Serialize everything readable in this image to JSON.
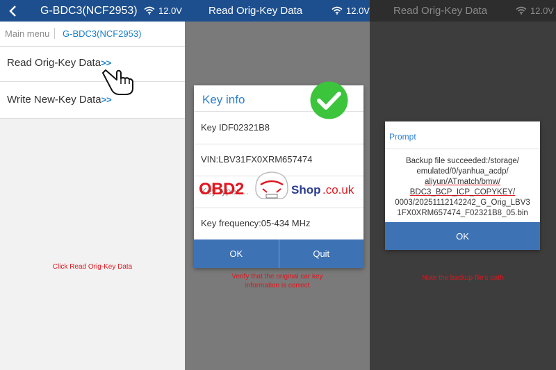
{
  "panel1": {
    "header": {
      "title": "G-BDC3(NCF2953)",
      "voltage": "12.0V"
    },
    "breadcrumb": {
      "main": "Main menu",
      "current": "G-BDC3(NCF2953)"
    },
    "menu": [
      {
        "label": "Read Orig-Key Data",
        "arrows": ">>"
      },
      {
        "label": "Write New-Key Data",
        "arrows": ">>"
      }
    ],
    "caption": "Click Read Orig-Key Data"
  },
  "panel2": {
    "header": {
      "title": "Read Orig-Key Data",
      "voltage": "12.0V"
    },
    "dialog": {
      "title": "Key info",
      "key_id": "Key IDF02321B8",
      "vin": "VIN:LBV31FX0XRM657474",
      "key_type": "Key type: ...",
      "frequency": "Key frequency:05-434 MHz",
      "ok": "OK",
      "quit": "Quit"
    },
    "caption_line1": "Verify that the original car key",
    "caption_line2": "information is correct"
  },
  "watermark": {
    "brand": "OBD2",
    "shop": "Shop",
    "tld": ".co.uk"
  },
  "panel3": {
    "header": {
      "title": "Read Orig-Key Data",
      "voltage": "12.0V"
    },
    "dialog": {
      "title": "Prompt",
      "lines": [
        "Backup file succeeded:/storage/",
        "emulated/0/yanhua_acdp/",
        "aliyun/ATmatch/bmw/",
        "BDC3_BCP_ICP_COPYKEY/",
        "0003/20251112142242_G_Orig_LBV3",
        "1FX0XRM657474_F02321B8_05.bin"
      ],
      "ok": "OK"
    },
    "caption": "Note the backup file's path"
  },
  "colors": {
    "header_blue": "#1d4f8e",
    "link_blue": "#1a7fc9",
    "button_blue": "#3d72b4",
    "caption_red": "#e0161e",
    "check_green": "#3cc43c"
  },
  "icons": [
    "back-arrow-icon",
    "wifi-icon",
    "pointing-hand-icon",
    "checkmark-icon"
  ]
}
